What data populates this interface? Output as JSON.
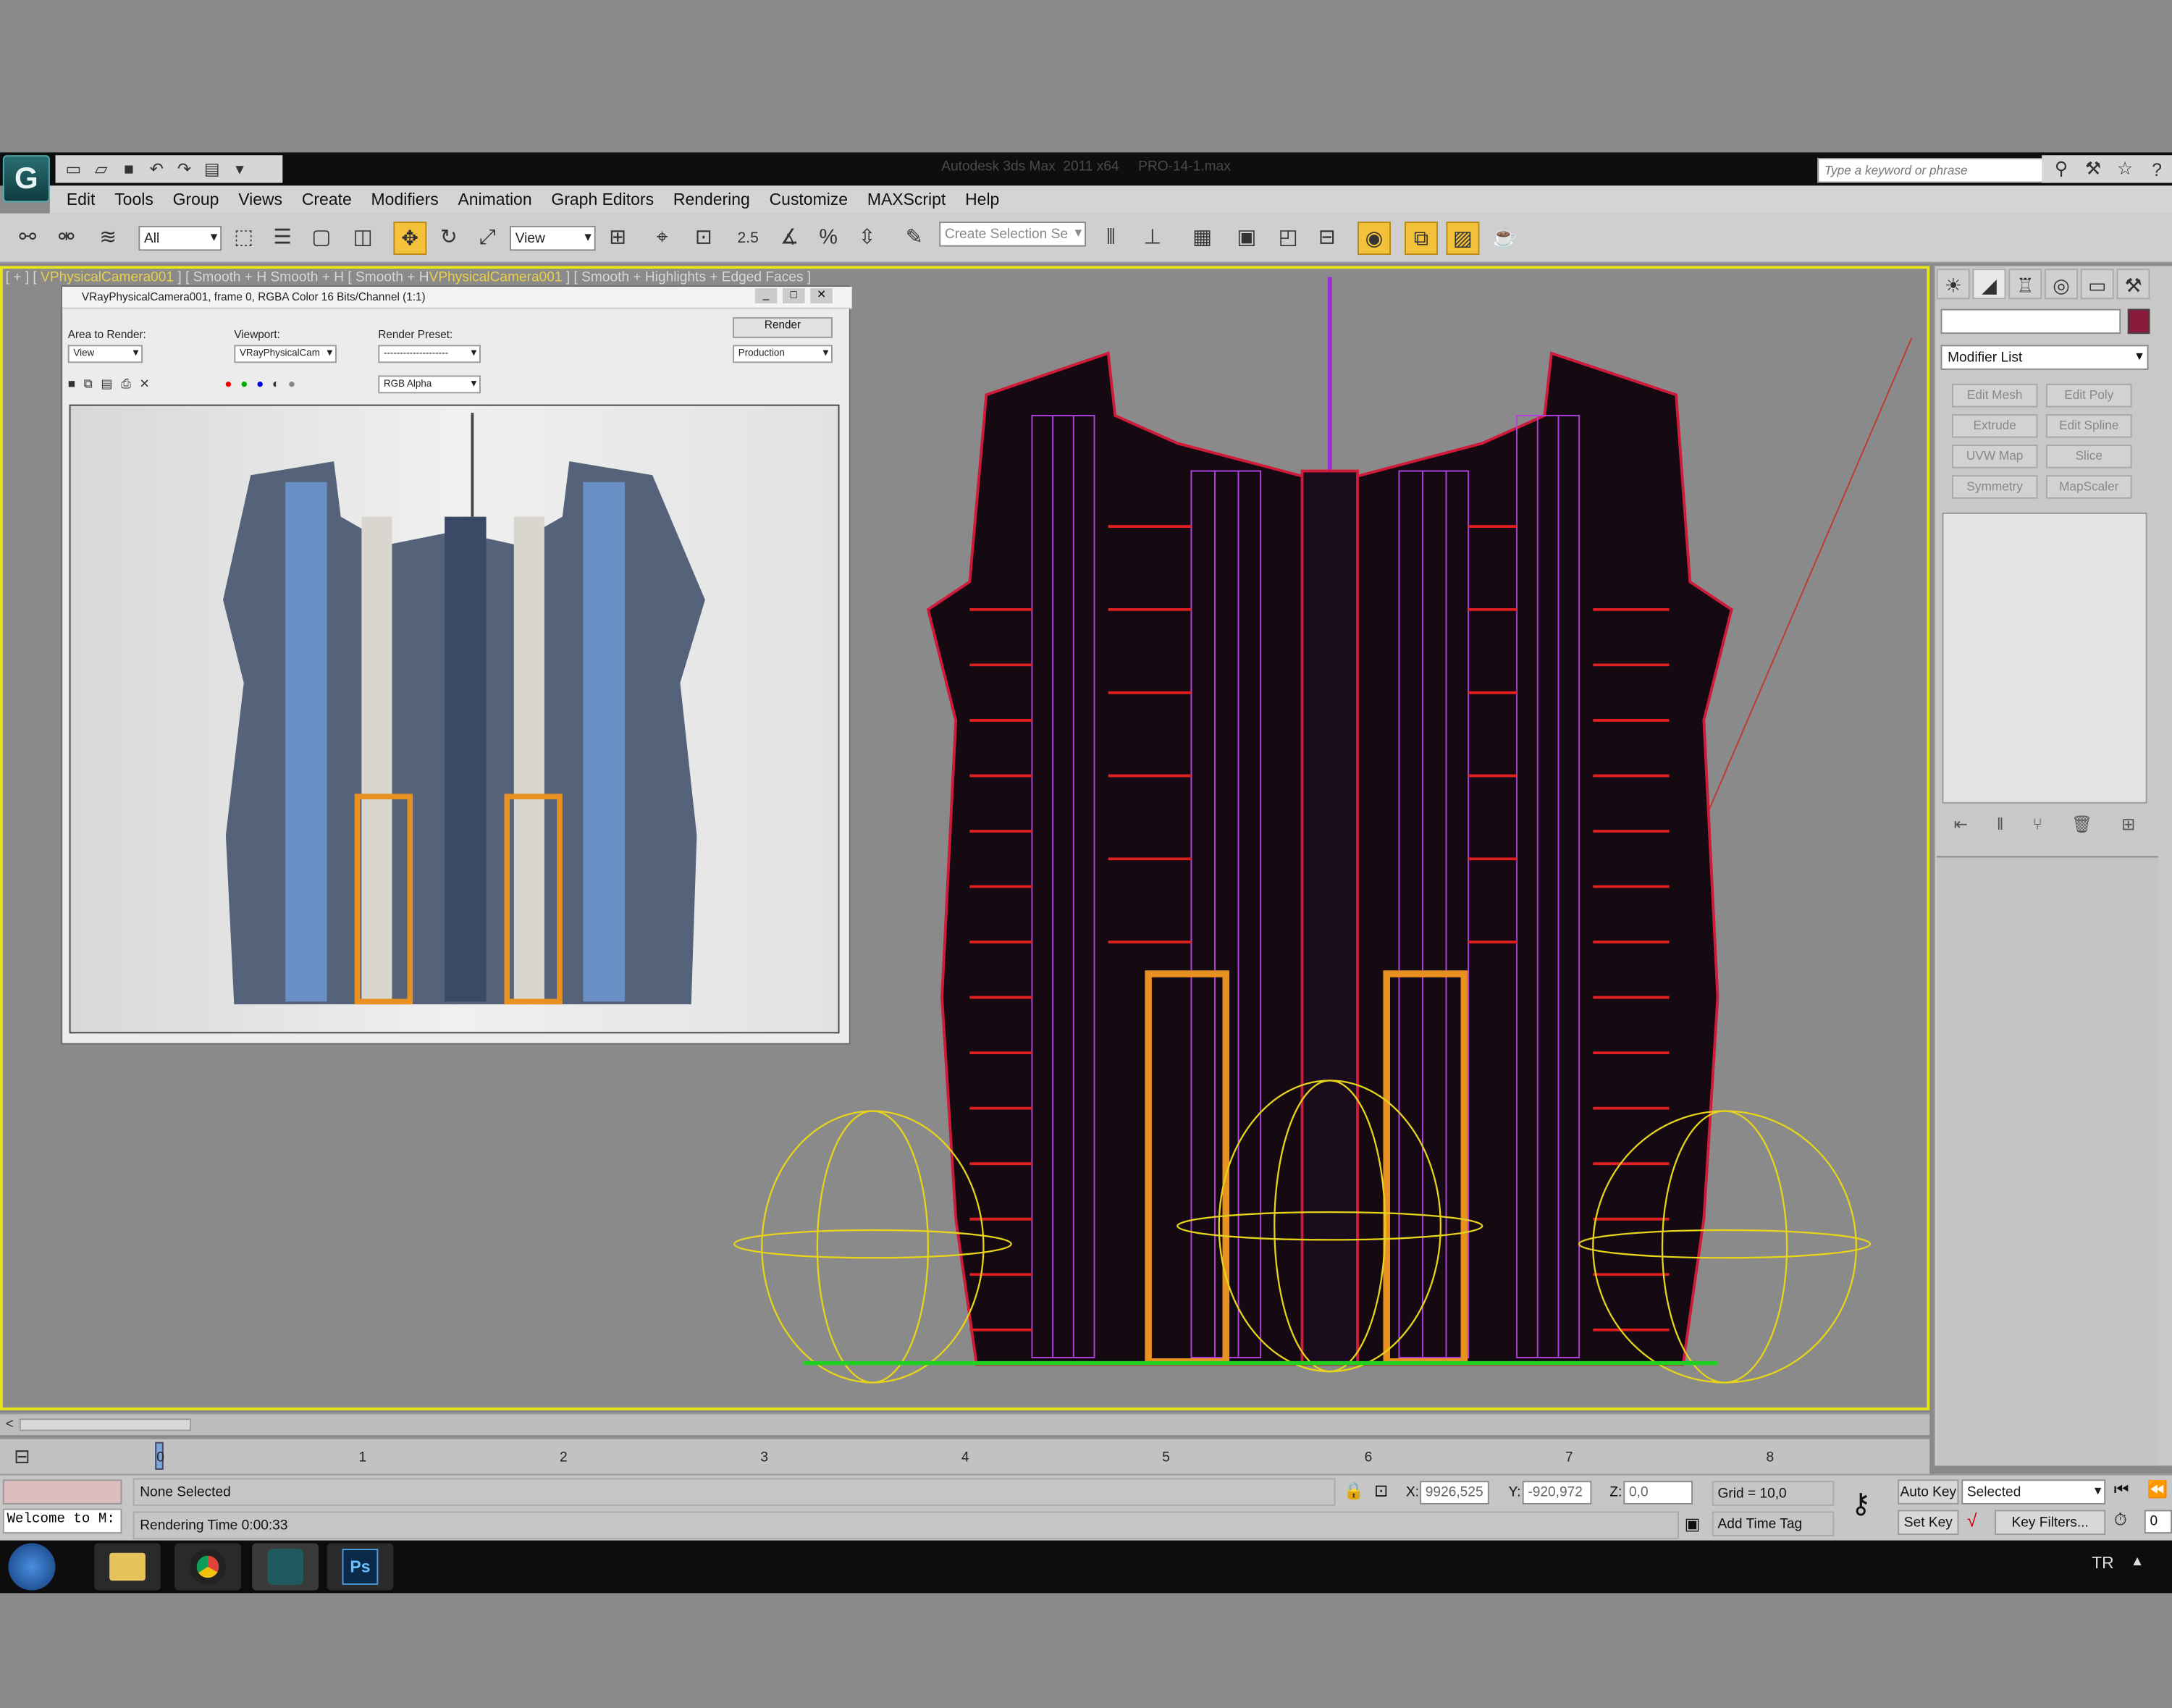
{
  "app": {
    "window_title": "Autodesk 3ds Max  2011 x64     PRO-14-1.max",
    "logo_glyph": "G",
    "help_search_placeholder": "Type a keyword or phrase"
  },
  "menu": [
    "Edit",
    "Tools",
    "Group",
    "Views",
    "Create",
    "Modifiers",
    "Animation",
    "Graph Editors",
    "Rendering",
    "Customize",
    "MAXScript",
    "Help"
  ],
  "toolbar": {
    "selection_filter": "All",
    "coordinate_system": "View",
    "snap_angle_label": "2.5",
    "named_selection_placeholder": "Create Selection Se"
  },
  "viewport": {
    "label_prefix": "[ + ] [ ",
    "camera_name": "VPhysicalCamera001",
    "label_suffix": " ] [ Smooth + H Smooth + H [ Smooth + H",
    "camera_name_2": "VPhysicalCamera001",
    "label_suffix_2": " ] [ Smooth + Highlights + Edged Faces ]"
  },
  "frame_window": {
    "title": "VRayPhysicalCamera001, frame 0, RGBA Color 16 Bits/Channel (1:1)",
    "area_label": "Area to Render:",
    "area_value": "View",
    "viewport_label": "Viewport:",
    "viewport_value": "VRayPhysicalCam",
    "preset_label": "Render Preset:",
    "preset_value": "--------------------",
    "render_button": "Render",
    "production_value": "Production",
    "channel_value": "RGB Alpha"
  },
  "command_panel": {
    "modifier_list": "Modifier List",
    "swatch_color": "#8a1a3a",
    "buttons": [
      "Edit Mesh",
      "Edit Poly",
      "Extrude",
      "Edit Spline",
      "UVW Map",
      "Slice",
      "Symmetry",
      "MapScaler"
    ]
  },
  "timeline": {
    "frame_marker": "0",
    "ticks": [
      "0",
      "1",
      "2",
      "3",
      "4",
      "5",
      "6",
      "7",
      "8"
    ]
  },
  "status": {
    "welcome": "Welcome to M:",
    "selection": "None Selected",
    "render_time": "Rendering Time  0:00:33",
    "x_label": "X:",
    "x_value": "9926,525",
    "y_label": "Y:",
    "y_value": "-920,972",
    "z_label": "Z:",
    "z_value": "0,0",
    "grid": "Grid = 10,0",
    "add_time_tag": "Add Time Tag",
    "auto_key": "Auto Key",
    "set_key": "Set Key",
    "selected_dropdown": "Selected",
    "key_filters": "Key Filters...",
    "frame_field": "0"
  },
  "taskbar": {
    "language": "TR",
    "apps": [
      "explorer-icon",
      "chrome-icon",
      "3dsmax-icon",
      "photoshop-icon"
    ],
    "photoshop_label": "Ps"
  }
}
